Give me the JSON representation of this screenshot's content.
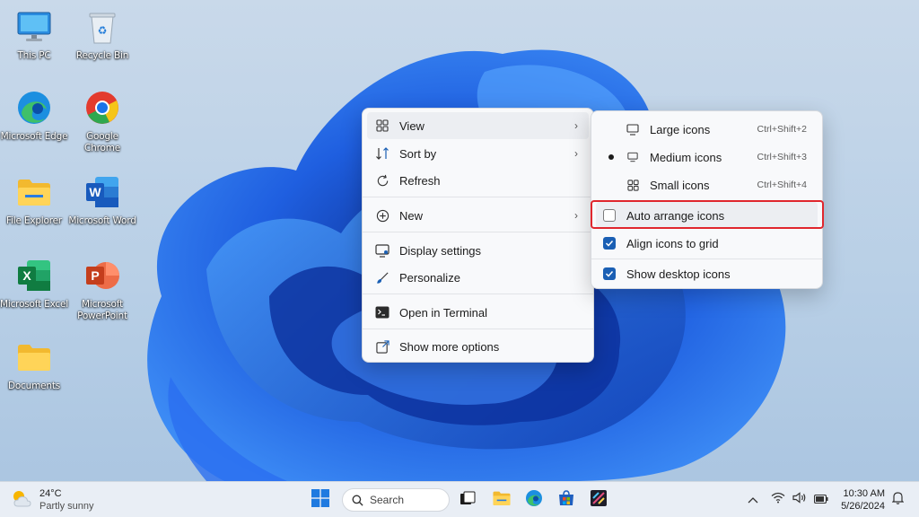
{
  "desktop": {
    "icons": [
      {
        "label": "This PC",
        "icon": "monitor-icon"
      },
      {
        "label": "Recycle Bin",
        "icon": "recycle-bin-icon"
      },
      {
        "label": "Microsoft Edge",
        "icon": "edge-icon"
      },
      {
        "label": "Google Chrome",
        "icon": "chrome-icon"
      },
      {
        "label": "File Explorer",
        "icon": "folder-icon"
      },
      {
        "label": "Microsoft Word",
        "icon": "word-icon"
      },
      {
        "label": "Microsoft Excel",
        "icon": "excel-icon"
      },
      {
        "label": "Microsoft PowerPoint",
        "icon": "powerpoint-icon"
      },
      {
        "label": "Documents",
        "icon": "folder-icon"
      }
    ]
  },
  "context_menu": {
    "items": [
      {
        "label": "View",
        "icon": "grid-view-icon",
        "has_submenu": true
      },
      {
        "label": "Sort by",
        "icon": "sort-icon",
        "has_submenu": true
      },
      {
        "label": "Refresh",
        "icon": "refresh-icon"
      },
      {
        "label": "New",
        "icon": "plus-circle-icon",
        "has_submenu": true
      },
      {
        "label": "Display settings",
        "icon": "display-icon"
      },
      {
        "label": "Personalize",
        "icon": "brush-icon"
      },
      {
        "label": "Open in Terminal",
        "icon": "terminal-icon"
      },
      {
        "label": "Show more options",
        "icon": "share-icon"
      }
    ]
  },
  "view_submenu": {
    "items": [
      {
        "label": "Large icons",
        "shortcut": "Ctrl+Shift+2",
        "icon": "monitor-icon",
        "selected": false
      },
      {
        "label": "Medium icons",
        "shortcut": "Ctrl+Shift+3",
        "icon": "monitor-icon",
        "selected": true
      },
      {
        "label": "Small icons",
        "shortcut": "Ctrl+Shift+4",
        "icon": "grid-view-icon",
        "selected": false
      },
      {
        "label": "Auto arrange icons",
        "checked": false
      },
      {
        "label": "Align icons to grid",
        "checked": true
      },
      {
        "label": "Show desktop icons",
        "checked": true
      }
    ]
  },
  "taskbar": {
    "weather": {
      "temp": "24°C",
      "desc": "Partly sunny"
    },
    "search_placeholder": "Search",
    "clock": {
      "time": "10:30 AM",
      "date": "5/26/2024"
    }
  },
  "colors": {
    "accent": "#1a5fb4",
    "highlight_outline": "#e0262d"
  }
}
